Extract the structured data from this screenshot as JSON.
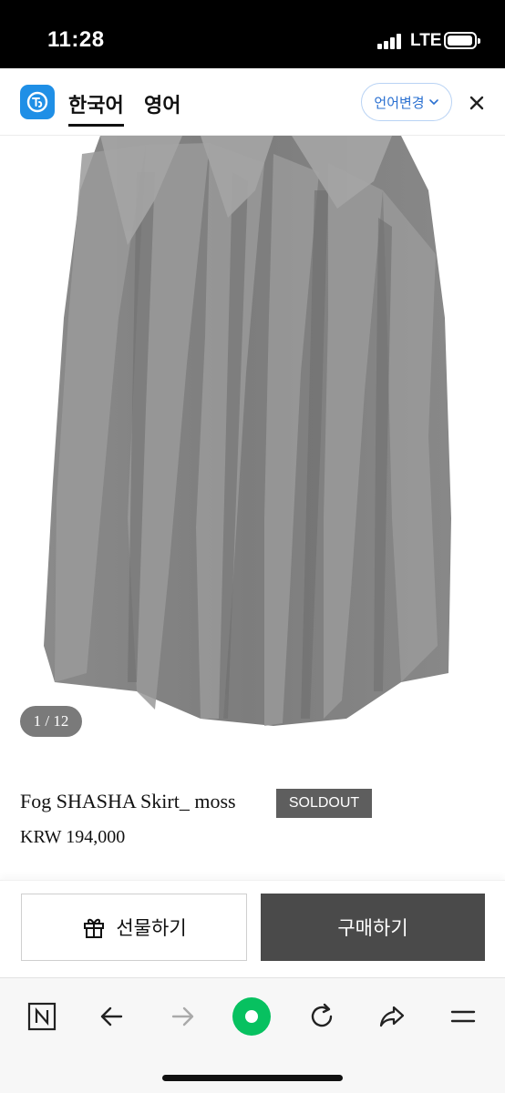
{
  "status_bar": {
    "time": "11:28",
    "network": "LTE"
  },
  "header": {
    "logo_icon": "translate-logo-icon",
    "lang_tabs": [
      {
        "label": "한국어",
        "active": true
      },
      {
        "label": "영어",
        "active": false
      }
    ],
    "change_language_label": "언어변경",
    "close_icon": "close-icon"
  },
  "product": {
    "image_alt": "skirt-photo",
    "image_counter": "1 / 12",
    "name": "Fog SHASHA Skirt_ moss",
    "badge": "SOLDOUT",
    "price": "KRW 194,000"
  },
  "actions": {
    "gift_label": "선물하기",
    "gift_icon": "gift-icon",
    "buy_label": "구매하기"
  },
  "browser_toolbar": {
    "items": [
      "naver-n-icon",
      "back-arrow-icon",
      "forward-arrow-icon",
      "green-dot-icon",
      "reload-icon",
      "share-icon",
      "menu-icon"
    ]
  },
  "colors": {
    "accent_blue": "#1f8fe6",
    "badge_gray": "#5e5e5e",
    "buy_button": "#4a4a4a",
    "green_button": "#07c160"
  }
}
